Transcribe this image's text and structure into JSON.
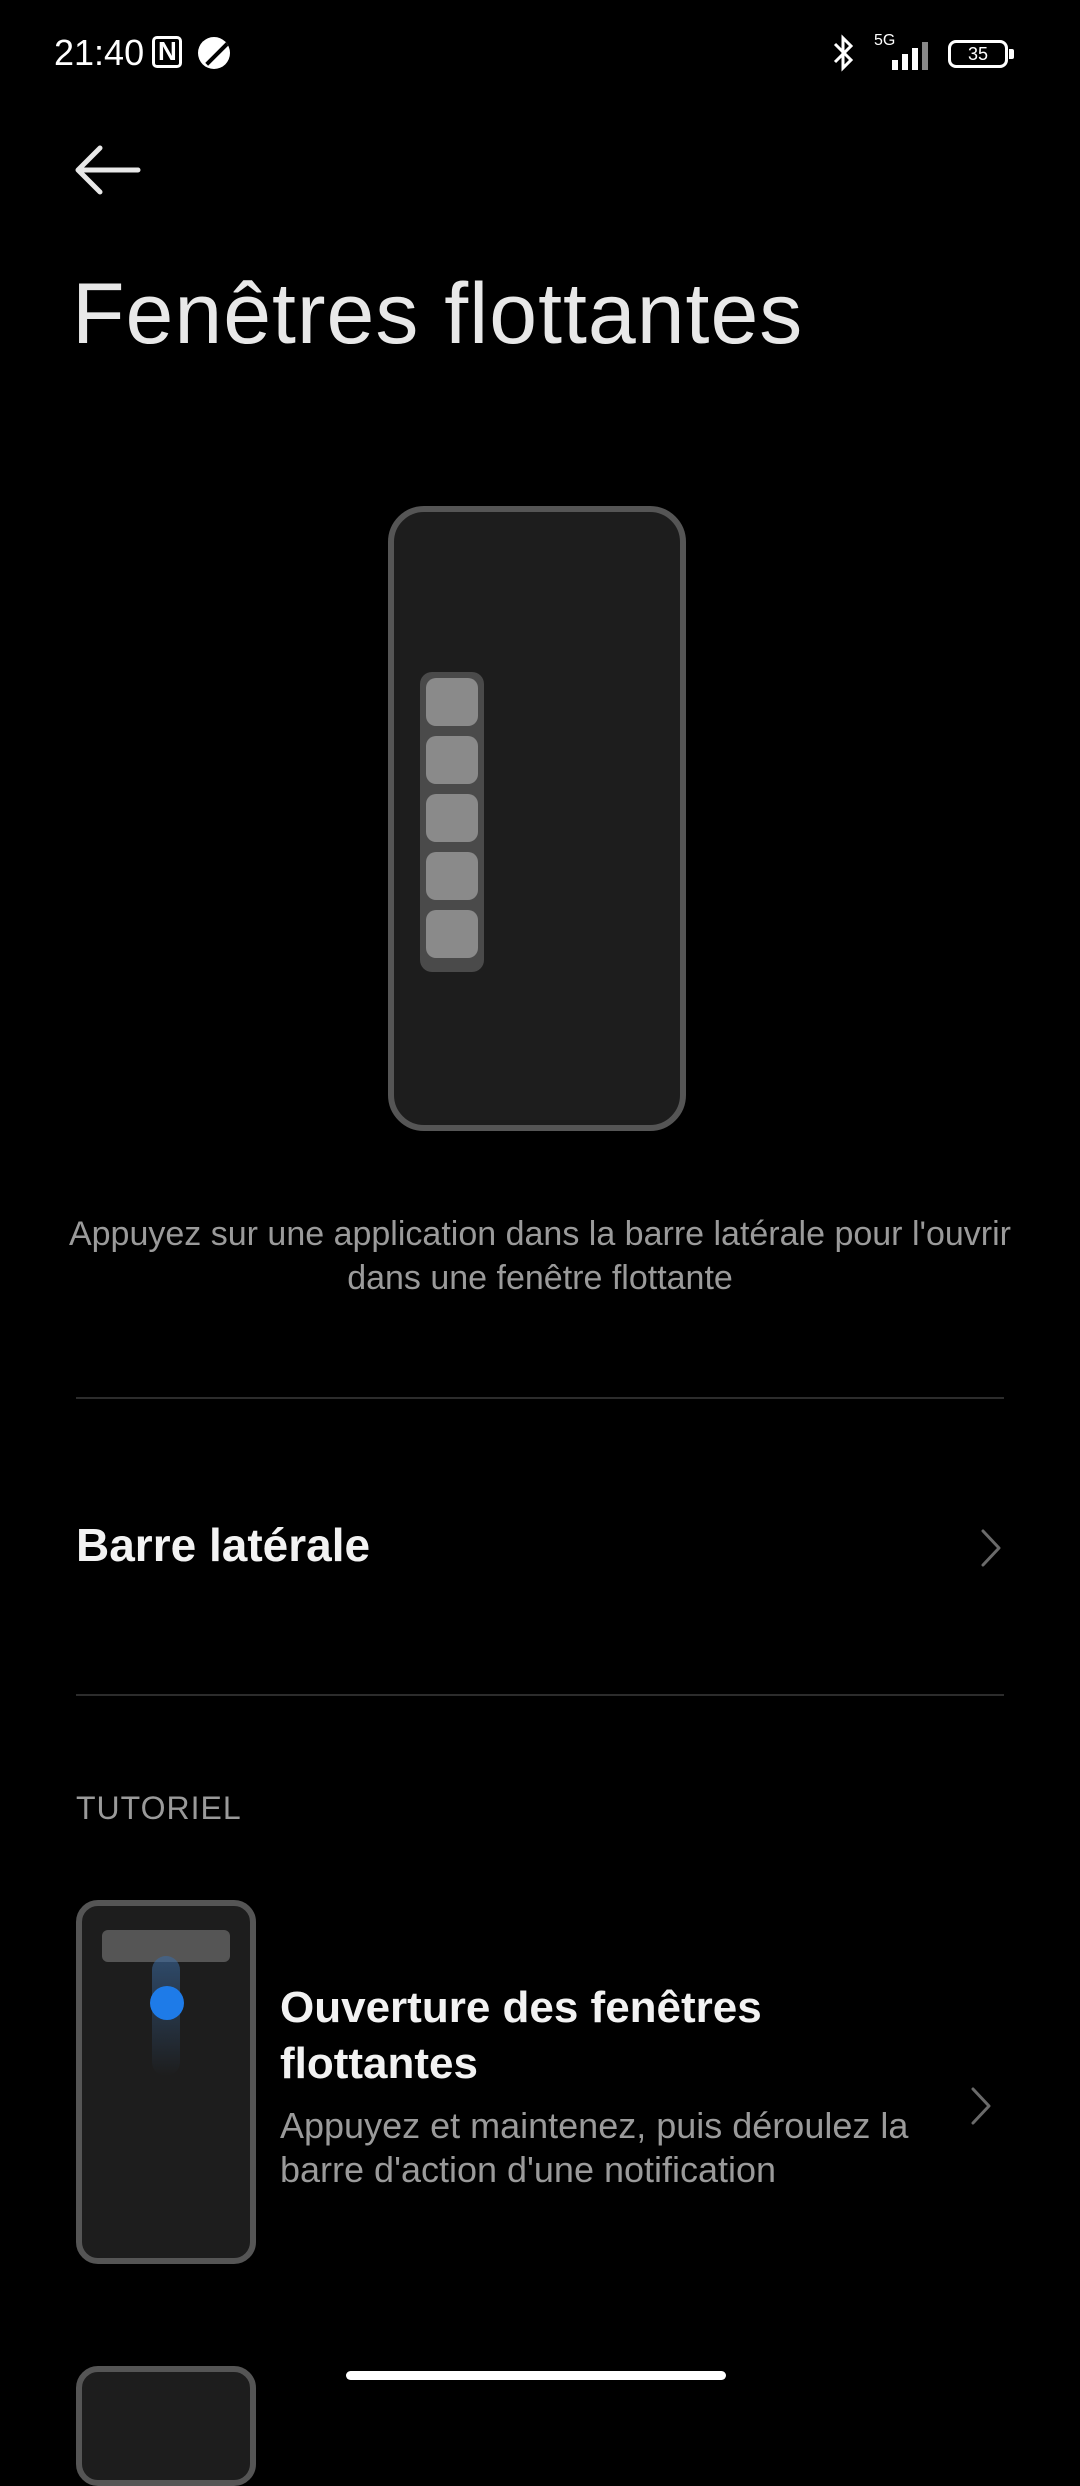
{
  "status_bar": {
    "time": "21:40",
    "network_label": "5G",
    "battery_level": "35",
    "icons": [
      "nfc-icon",
      "app-dot-icon",
      "bluetooth-icon",
      "signal-icon",
      "battery-icon"
    ]
  },
  "header": {
    "back_icon": "arrow-left-icon",
    "title": "Fenêtres flottantes"
  },
  "illustration": {
    "caption": "Appuyez sur une application dans la barre latérale pour l'ouvrir dans une fenêtre flottante"
  },
  "settings": {
    "sidebar_row_label": "Barre latérale",
    "chevron_icon": "chevron-right-icon"
  },
  "tutorial": {
    "section_label": "TUTORIEL",
    "items": [
      {
        "title": "Ouverture des fenêtres flottantes",
        "description": "Appuyez et maintenez, puis déroulez la barre d'action d'une notification"
      }
    ]
  },
  "colors": {
    "background": "#000000",
    "text_primary": "#f2f2f2",
    "text_secondary": "#9a9a9a",
    "accent": "#1e7be8"
  }
}
